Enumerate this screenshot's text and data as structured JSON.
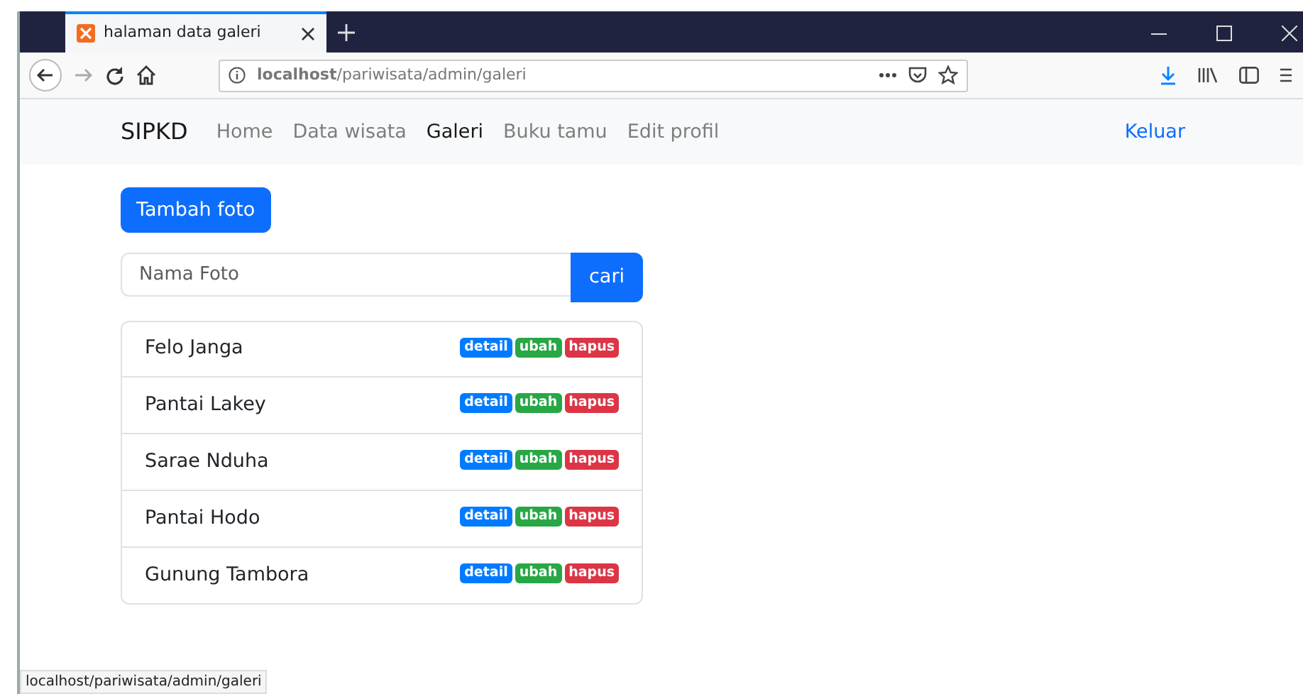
{
  "browser": {
    "tab_title": "halaman data galeri",
    "url": "**localhost**/pariwisata/admin/galeri",
    "status_url": "localhost/pariwisata/admin/galeri"
  },
  "navbar": {
    "brand": "SIPKD",
    "links": [
      {
        "label": "Home",
        "selected": false
      },
      {
        "label": "Data wisata",
        "selected": false
      },
      {
        "label": "Galeri",
        "selected": true
      },
      {
        "label": "Buku tamu",
        "selected": false
      },
      {
        "label": "Edit profil",
        "selected": false
      }
    ],
    "logout": "Keluar"
  },
  "add_button": "Tambah foto",
  "search": {
    "placeholder": "Nama Foto",
    "button": "cari"
  },
  "photos": [
    {
      "name": "Felo Janga",
      "actions": [
        {
          "label": "detail",
          "kind": "detail"
        },
        {
          "label": "ubah",
          "kind": "edit"
        },
        {
          "label": "hapus",
          "kind": "delete"
        }
      ]
    },
    {
      "name": "Pantai Lakey",
      "actions": [
        {
          "label": "detail",
          "kind": "detail"
        },
        {
          "label": "ubah",
          "kind": "edit"
        },
        {
          "label": "hapus",
          "kind": "delete"
        }
      ]
    },
    {
      "name": "Sarae Nduha",
      "actions": [
        {
          "label": "detail",
          "kind": "detail"
        },
        {
          "label": "ubah",
          "kind": "edit"
        },
        {
          "label": "hapus",
          "kind": "delete"
        }
      ]
    },
    {
      "name": "Pantai Hodo",
      "actions": [
        {
          "label": "detail",
          "kind": "detail"
        },
        {
          "label": "ubah",
          "kind": "edit"
        },
        {
          "label": "hapus",
          "kind": "delete"
        }
      ]
    },
    {
      "name": "Gunung Tambora",
      "actions": [
        {
          "label": "detail",
          "kind": "detail"
        },
        {
          "label": "ubah",
          "kind": "edit"
        },
        {
          "label": "hapus",
          "kind": "delete"
        }
      ]
    }
  ]
}
